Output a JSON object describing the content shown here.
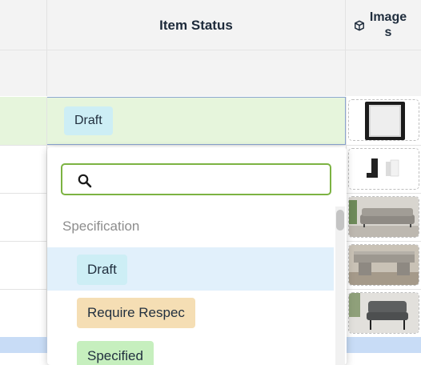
{
  "header": {
    "status_title": "Item Status",
    "images_title": "Images"
  },
  "selected_row": {
    "status": "Draft"
  },
  "dropdown": {
    "search_value": "",
    "section_label": "Specification",
    "options": [
      {
        "label": "Draft",
        "color": "#cdeef5",
        "highlighted": true
      },
      {
        "label": "Require Respec",
        "color": "#f5deb4",
        "highlighted": false
      },
      {
        "label": "Specified",
        "color": "#c6efbe",
        "highlighted": false
      }
    ]
  },
  "thumbnails": [
    "mirror-image",
    "wall-hooks-image",
    "sofa-image",
    "coffee-table-image",
    "armchair-image"
  ],
  "colors": {
    "selected_row_bg": "#e6f5dc",
    "search_border": "#7cb342",
    "highlight_bg": "#e1f0fb"
  }
}
